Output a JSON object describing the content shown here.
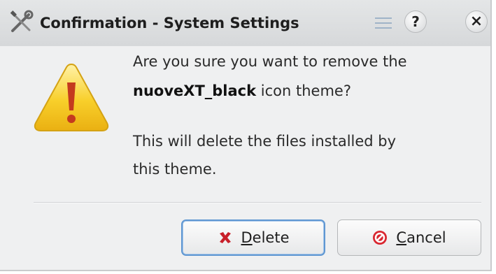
{
  "window": {
    "title": "Confirmation - System Settings",
    "help_label": "?",
    "close_label": "×"
  },
  "message": {
    "line1": "Are you sure you want to remove the",
    "theme_name": "nuoveXT_black",
    "line2_rest": " icon theme?",
    "line3": "This will delete the files installed by",
    "line4": "this theme."
  },
  "buttons": {
    "delete_mnemonic": "D",
    "delete_rest": "elete",
    "cancel_mnemonic": "C",
    "cancel_rest": "ancel"
  },
  "icons": {
    "app": "tools-icon",
    "menu": "menu-icon",
    "warning": "warning-icon",
    "delete": "red-x-icon",
    "cancel": "cancel-icon"
  },
  "colors": {
    "warning_fill": "#f5c518",
    "delete_icon": "#c8202a",
    "cancel_icon": "#d9262f",
    "focus_border": "#5f97d2"
  }
}
